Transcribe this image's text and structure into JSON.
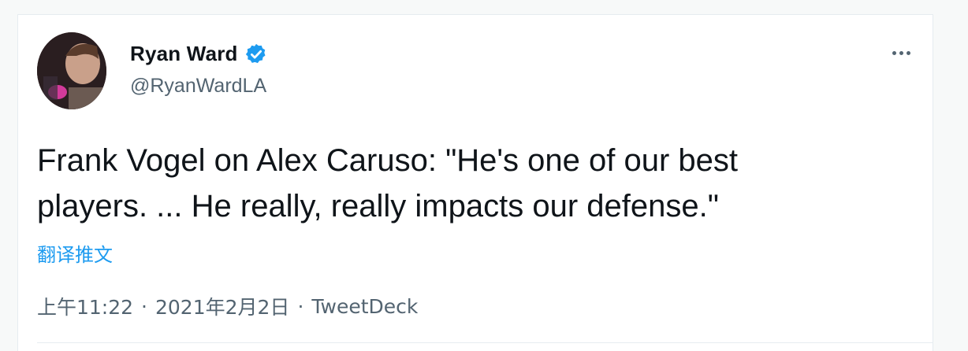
{
  "tweet": {
    "author": {
      "display_name": "Ryan Ward",
      "handle": "@RyanWardLA",
      "verified": true,
      "avatar_icon": "avatar-photo"
    },
    "text_line1": "Frank Vogel on Alex Caruso: \"He's one of our best",
    "text_line2": "players. ... He really, really impacts our defense.\"",
    "translate_label": "翻译推文",
    "time": "上午11:22",
    "date": "2021年2月2日",
    "separator": "·",
    "source": "TweetDeck",
    "more_icon": "more-options-icon"
  },
  "colors": {
    "link": "#1d9bf0",
    "secondary": "#536471",
    "primary_text": "#0f1419",
    "verified": "#1d9bf0"
  }
}
